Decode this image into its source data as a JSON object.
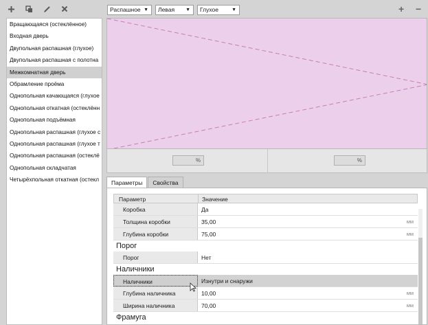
{
  "toolbar_left": {
    "icons": [
      "plus-icon",
      "copy-icon",
      "pencil-icon",
      "close-icon"
    ]
  },
  "left_list": {
    "items": [
      "Вращающаяся (остеклённое)",
      "Входная дверь",
      "Двупольная распашная (глухое)",
      "Двупольная распашная с полотна",
      "Межкомнатная дверь",
      "Обрамление проёма",
      "Однопольная качающаяся (глухое",
      "Однопольная откатная (остеклённ",
      "Однопольная подъёмная",
      "Однопольная распашная (глухое с",
      "Однопольная распашная (глухое т",
      "Однопольная распашная (остеклё",
      "Однопольная складчатая",
      "Четырёхпольная откатная (остекл"
    ],
    "selected_index": 4
  },
  "top_toolbar": {
    "dropdown1": "Распашное",
    "dropdown2": "Левая",
    "dropdown3": "Глухое",
    "add_symbol": "+",
    "remove_symbol": "−"
  },
  "preview": {
    "fill_color": "#eccfea",
    "line_color": "#c87cb6"
  },
  "percent": {
    "left_value": "%",
    "right_value": "%"
  },
  "tabs": {
    "params": "Параметры",
    "props": "Свойства"
  },
  "grid": {
    "header_param": "Параметр",
    "header_value": "Значение",
    "rows": [
      {
        "type": "row",
        "name": "Коробка",
        "value": "Да",
        "unit": ""
      },
      {
        "type": "row",
        "name": "Толщина коробки",
        "value": "35,00",
        "unit": "мм"
      },
      {
        "type": "row",
        "name": "Глубина коробки",
        "value": "75,00",
        "unit": "мм"
      },
      {
        "type": "section",
        "name": "Порог"
      },
      {
        "type": "row",
        "name": "Порог",
        "value": "Нет",
        "unit": ""
      },
      {
        "type": "section",
        "name": "Наличники"
      },
      {
        "type": "row",
        "name": "Наличники",
        "value": "Изнутри и снаружи",
        "unit": "",
        "highlight": true
      },
      {
        "type": "row",
        "name": "Глубина наличника",
        "value": "10,00",
        "unit": "мм"
      },
      {
        "type": "row",
        "name": "Ширина наличника",
        "value": "70,00",
        "unit": "мм"
      },
      {
        "type": "section",
        "name": "Фрамуга"
      }
    ]
  }
}
